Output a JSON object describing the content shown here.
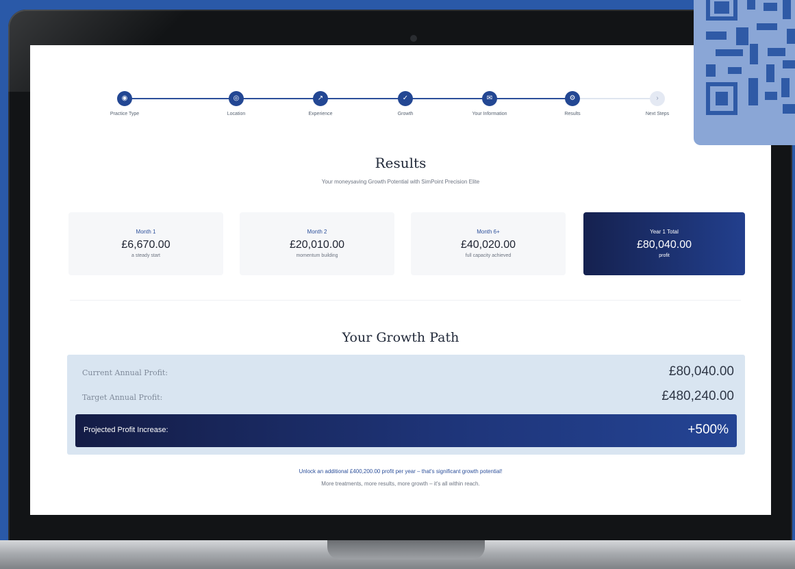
{
  "stepper": {
    "steps": [
      {
        "label": "Practice Type",
        "icon": "person-icon",
        "glyph": "◉"
      },
      {
        "label": "Location",
        "icon": "location-icon",
        "glyph": "◎"
      },
      {
        "label": "Experience",
        "icon": "trend-icon",
        "glyph": "↗"
      },
      {
        "label": "Growth",
        "icon": "chart-icon",
        "glyph": "✓"
      },
      {
        "label": "Your Information",
        "icon": "mail-icon",
        "glyph": "✉"
      },
      {
        "label": "Results",
        "icon": "gear-icon",
        "glyph": "⚙"
      },
      {
        "label": "Next Steps",
        "icon": "arrow-icon",
        "glyph": "›"
      }
    ]
  },
  "results": {
    "title": "Results",
    "subtitle": "Your moneysaving Growth Potential with SimPoint Precision Elite"
  },
  "cards": [
    {
      "label": "Month 1",
      "value": "£6,670.00",
      "sub": "a steady start"
    },
    {
      "label": "Month 2",
      "value": "£20,010.00",
      "sub": "momentum building"
    },
    {
      "label": "Month 6+",
      "value": "£40,020.00",
      "sub": "full capacity achieved"
    },
    {
      "label": "Year 1 Total",
      "value": "£80,040.00",
      "sub": "profit"
    }
  ],
  "growth": {
    "title": "Your Growth Path",
    "current_label": "Current Annual Profit:",
    "current_value": "£80,040.00",
    "target_label": "Target Annual Profit:",
    "target_value": "£480,240.00",
    "projected_label": "Projected Profit Increase:",
    "projected_value": "+500%"
  },
  "footer": {
    "line1": "Unlock an additional £400,200.00 profit per year – that's significant growth potential!",
    "line2": "More treatments, more results, more growth – it's all within reach."
  },
  "colors": {
    "accent": "#234793",
    "background": "#2a59a8",
    "panel": "#d9e5f1"
  }
}
